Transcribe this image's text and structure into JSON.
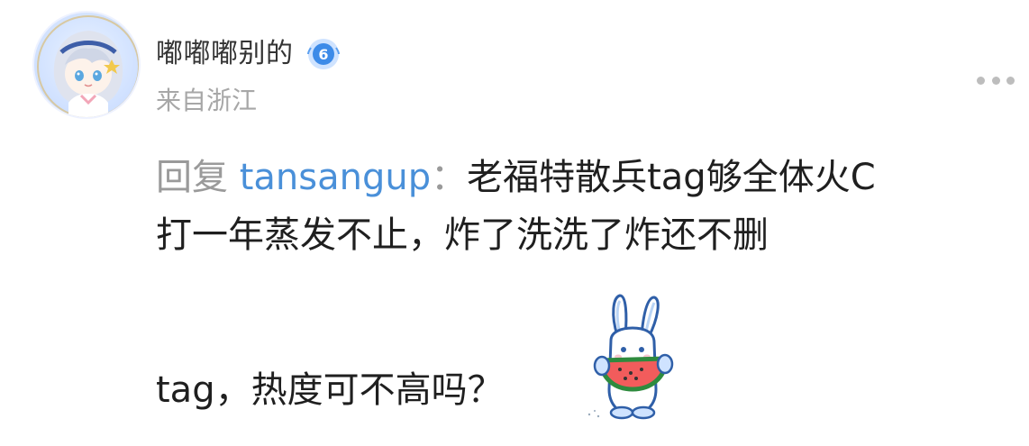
{
  "header": {
    "username": "嘟嘟嘟别的",
    "level": "6",
    "location": "来自浙江"
  },
  "comment": {
    "reply_prefix": "回复",
    "reply_user": "tansangup",
    "reply_colon": "：",
    "line1_text": "老福特散兵tag够全体火C",
    "line2_text": "打一年蒸发不止，炸了洗洗了炸还不删",
    "line3_text": "tag，热度可不高吗？"
  },
  "icons": {
    "more": "more-horizontal-icon",
    "level_badge": "level-badge-icon",
    "sticker": "rabbit-watermelon-sticker"
  },
  "colors": {
    "link_blue": "#4a90d9",
    "muted_gray": "#9a9a9a",
    "badge_blue": "#3d8be8"
  }
}
